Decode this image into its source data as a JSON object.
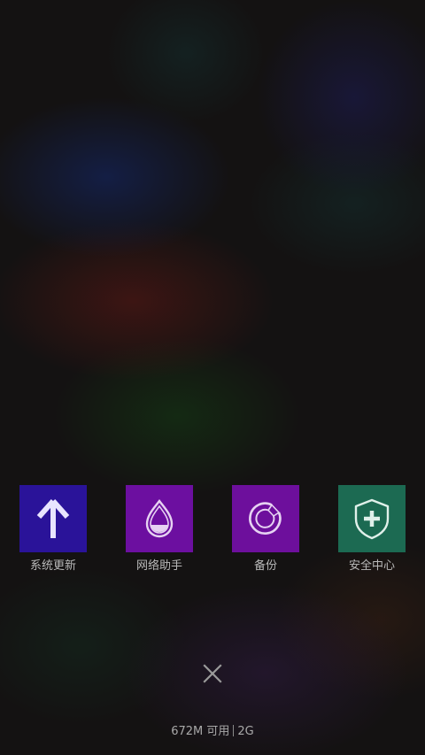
{
  "recent_tasks": {
    "tiles": [
      {
        "label": "系统更新",
        "icon": "arrow-up-icon",
        "color": "#2a1399"
      },
      {
        "label": "网络助手",
        "icon": "water-drop-icon",
        "color": "#6c0fa0"
      },
      {
        "label": "备份",
        "icon": "backup-circle-icon",
        "color": "#6d0f9c"
      },
      {
        "label": "安全中心",
        "icon": "shield-plus-icon",
        "color": "#1c6a52"
      }
    ]
  },
  "footer": {
    "memory_text": "672M 可用",
    "total_memory": "2G"
  }
}
